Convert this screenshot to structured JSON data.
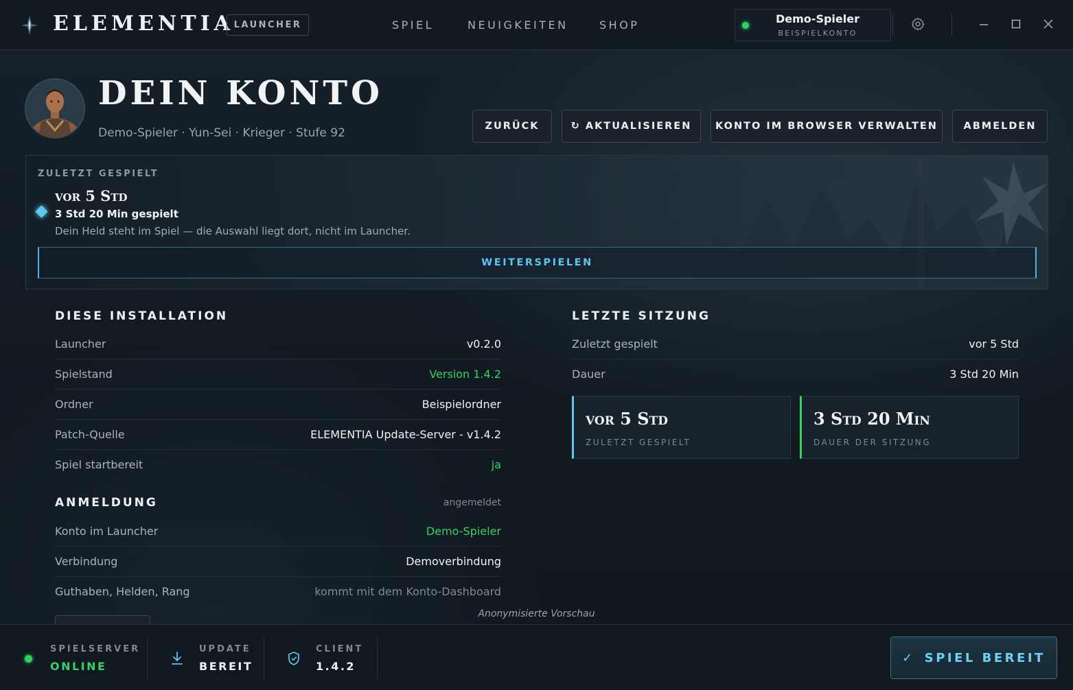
{
  "app": {
    "brand": "ELEMENTIA",
    "badge": "LAUNCHER",
    "nav": [
      "SPIEL",
      "NEUIGKEITEN",
      "SHOP"
    ],
    "user": {
      "name": "Demo-Spieler",
      "sub": "BEISPIELKONTO"
    },
    "icons": {
      "logo": "elementia-logo-icon",
      "settings": "gear-icon",
      "minimize": "minimize-icon",
      "maximize": "maximize-icon",
      "close": "close-icon"
    }
  },
  "header": {
    "title": "DEIN KONTO",
    "subtitle": "Demo-Spieler · Yun-Sei · Krieger · Stufe 92",
    "buttons": {
      "back": "ZURÜCK",
      "refresh": "↻ AKTUALISIEREN",
      "manage": "KONTO IM BROWSER VERWALTEN",
      "logout": "ABMELDEN"
    }
  },
  "last_played": {
    "label": "ZULETZT GESPIELT",
    "title": "vor 5 Std",
    "played": "3 Std 20 Min gespielt",
    "note": "Dein Held steht im Spiel — die Auswahl liegt dort, nicht im Launcher.",
    "button": "WEITERSPIELEN"
  },
  "installation": {
    "title": "DIESE INSTALLATION",
    "rows": [
      {
        "k": "Launcher",
        "v": "v0.2.0"
      },
      {
        "k": "Spielstand",
        "v": "Version 1.4.2"
      },
      {
        "k": "Ordner",
        "v": "Beispielordner"
      },
      {
        "k": "Patch-Quelle",
        "v": "ELEMENTIA Update-Server - v1.4.2"
      },
      {
        "k": "Spiel startbereit",
        "v": "ja"
      }
    ]
  },
  "login": {
    "title": "ANMELDUNG",
    "state": "angemeldet",
    "rows": [
      {
        "k": "Konto im Launcher",
        "v": "Demo-Spieler"
      },
      {
        "k": "Verbindung",
        "v": "Demoverbindung"
      },
      {
        "k": "Guthaben, Helden, Rang",
        "v": "kommt mit dem Konto-Dashboard"
      }
    ]
  },
  "session": {
    "title": "LETZTE SITZUNG",
    "rows": [
      {
        "k": "Zuletzt gespielt",
        "v": "vor 5 Std"
      },
      {
        "k": "Dauer",
        "v": "3 Std 20 Min"
      }
    ],
    "cards": [
      {
        "value": "vor 5 Std",
        "label": "ZULETZT GESPIELT",
        "accent": "#5cc8f0"
      },
      {
        "value": "3 Std 20 Min",
        "label": "DAUER DER SITZUNG",
        "accent": "#38d163"
      }
    ]
  },
  "preview_note": "Anonymisierte Vorschau",
  "status": {
    "server": {
      "label": "SPIELSERVER",
      "value": "ONLINE"
    },
    "update": {
      "label": "UPDATE",
      "value": "BEREIT"
    },
    "client": {
      "label": "CLIENT",
      "value": "1.4.2"
    },
    "play": "SPIEL BEREIT"
  },
  "colors": {
    "accent_blue": "#5cc8f0",
    "accent_green": "#38d163",
    "online": "#2fd160"
  }
}
